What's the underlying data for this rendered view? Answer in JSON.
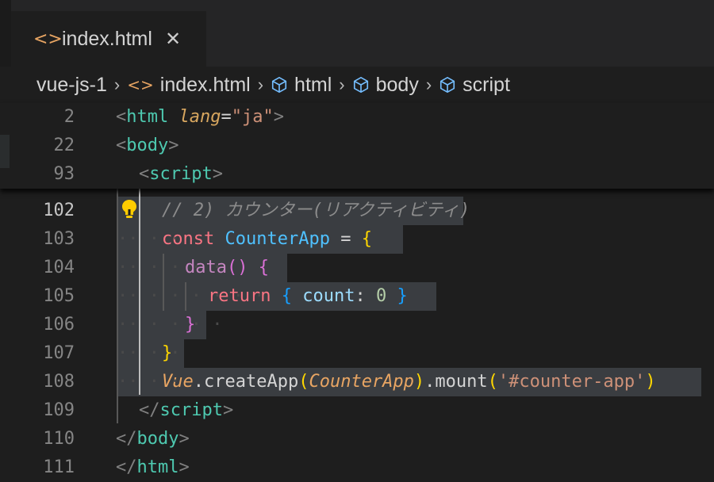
{
  "tab": {
    "icon": "code-brackets-icon",
    "label": "index.html",
    "close": "✕"
  },
  "breadcrumb": {
    "items": [
      "vue-js-1",
      "index.html",
      "html",
      "body",
      "script"
    ],
    "separator": "›"
  },
  "sticky_lines": [
    {
      "num": "2",
      "parts": [
        "<",
        "html",
        "lang",
        "=",
        "\"ja\"",
        ">"
      ]
    },
    {
      "num": "22",
      "parts": [
        "<",
        "body",
        ">"
      ]
    },
    {
      "num": "93",
      "parts": [
        "<",
        "script",
        ">"
      ]
    }
  ],
  "lines": {
    "l102": {
      "num": "102",
      "comment": "// 2) カウンター(リアクティビティ)"
    },
    "l103": {
      "num": "103",
      "kw": "const",
      "name": "CounterApp",
      "eq": "=",
      "open": "{"
    },
    "l104": {
      "num": "104",
      "fn": "data",
      "parens": "()",
      "open": "{"
    },
    "l105": {
      "num": "105",
      "kw": "return",
      "open": "{",
      "prop": "count",
      "colon": ":",
      "value": "0",
      "close": "}"
    },
    "l106": {
      "num": "106",
      "close": "}"
    },
    "l107": {
      "num": "107",
      "close": "}"
    },
    "l108": {
      "num": "108",
      "obj": "Vue",
      "dot1": ".",
      "method1": "createApp",
      "p1": "(",
      "arg": "CounterApp",
      "p2": ")",
      "dot2": ".",
      "method2": "mount",
      "p3": "(",
      "selector": "'#counter-app'",
      "p4": ")"
    },
    "l109": {
      "num": "109",
      "open": "</",
      "tag": "script",
      "close": ">"
    },
    "l110": {
      "num": "110",
      "open": "</",
      "tag": "body",
      "close": ">"
    },
    "l111": {
      "num": "111",
      "open": "</",
      "tag": "html",
      "close": ">"
    }
  },
  "active_line": "102",
  "icons": {
    "lightbulb": "lightbulb-icon",
    "cube": "symbol-cube-icon"
  },
  "colors": {
    "background": "#1e1e1e",
    "selection": "#3a3d41",
    "keyword": "#f97583",
    "class": "#4fc1ff",
    "string": "#ce9178",
    "tag": "#569cd6",
    "tag_name": "#4ec9b0",
    "lightbulb": "#ffcc00"
  }
}
